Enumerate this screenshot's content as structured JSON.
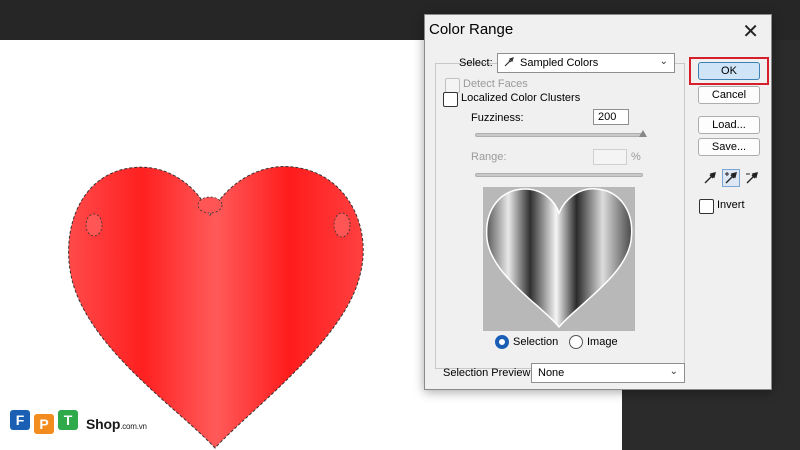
{
  "dialog": {
    "title": "Color Range",
    "select_label": "Select:",
    "select_value": "Sampled Colors",
    "detect_faces": "Detect Faces",
    "localized_clusters": "Localized Color Clusters",
    "fuzziness_label": "Fuzziness:",
    "fuzziness_value": "200",
    "fuzziness": 200,
    "fuzziness_max": 200,
    "range_label": "Range:",
    "range_unit": "%",
    "radio_selection": "Selection",
    "radio_image": "Image",
    "selected_view": "Selection",
    "selection_preview_label": "Selection Preview:",
    "selection_preview_value": "None",
    "buttons": {
      "ok": "OK",
      "cancel": "Cancel",
      "load": "Load...",
      "save": "Save..."
    },
    "invert": "Invert",
    "icons": [
      "close-icon",
      "eyedropper-icon",
      "eyedropper-plus-icon",
      "eyedropper-minus-icon",
      "chevron-down-icon"
    ]
  },
  "logo": {
    "brand": "FPT",
    "suffix": "Shop",
    "domain": ".com.vn"
  },
  "colors": {
    "heart": "#ff2a2a",
    "accent_blue": "#1a5fb4",
    "highlight_red": "#d61f2a"
  }
}
